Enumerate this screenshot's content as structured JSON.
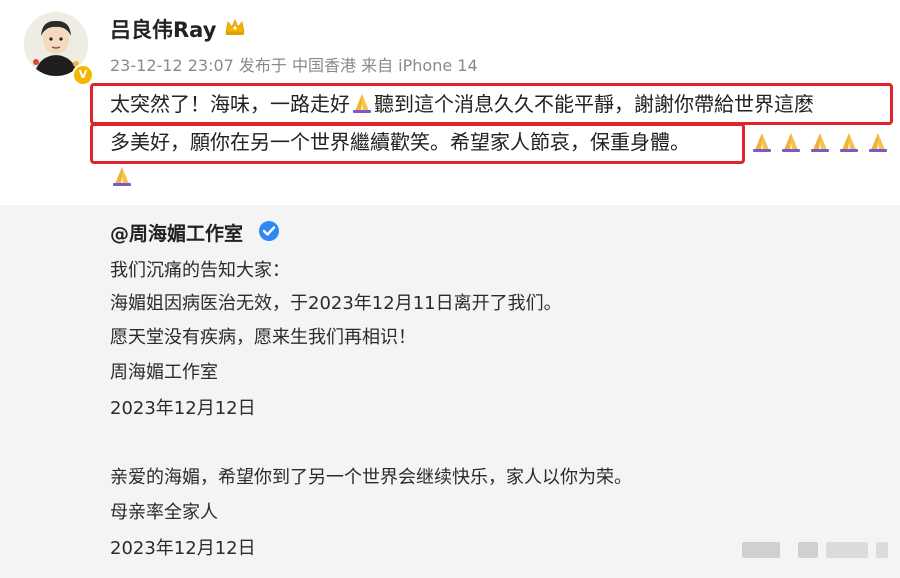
{
  "post": {
    "username": "吕良伟Ray",
    "meta": "23-12-12 23:07 发布于 中国香港 来自 iPhone 14",
    "line1_a": "太突然了！海味，一路走好",
    "line1_b": "聽到這个消息久久不能平靜，謝謝你帶給世界這麽",
    "line2": "多美好，願你在另一个世界繼續歡笑。希望家人節哀，保重身體。",
    "icons": {
      "avatar": "avatar-illustration",
      "verified_badge": "gold-v-badge",
      "crown": "crown-icon",
      "pray": "praying-hands-emoji"
    },
    "highlight_color": "#e0242d"
  },
  "repost": {
    "author": "@周海媚工作室",
    "verified_icon": "blue-v-check-icon",
    "lines": [
      "我们沉痛的告知大家：",
      "海媚姐因病医治无效，于2023年12月11日离开了我们。",
      "愿天堂没有疾病，愿来生我们再相识！",
      "周海媚工作室",
      "2023年12月12日",
      "亲爱的海媚，希望你到了另一个世界会继续快乐，家人以你为荣。",
      "母亲率全家人",
      "2023年12月12日"
    ],
    "background": "#f4f4f4"
  }
}
